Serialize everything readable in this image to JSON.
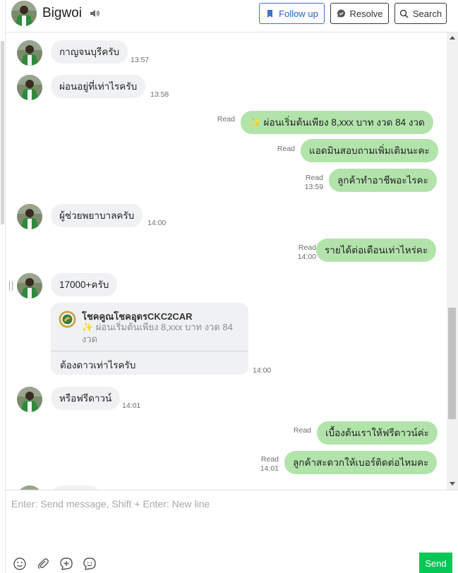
{
  "header": {
    "contact_name": "Bigwoi",
    "follow_up_label": "Follow up",
    "resolve_label": "Resolve",
    "search_label": "Search"
  },
  "messages": [
    {
      "dir": "in",
      "text": "กาญจนบุรีครับ",
      "time": "13:57"
    },
    {
      "dir": "in",
      "text": "ผ่อนอยู่ที่เท่าไรครับ",
      "time": "13:58"
    },
    {
      "dir": "out",
      "text": "✨ ผ่อนเริ่มต้นเพียง 8,xxx บาท งวด 84 งวด",
      "status": "Read",
      "time": ""
    },
    {
      "dir": "out",
      "text": "แอดมินสอบถามเพิ่มเติมนะคะ",
      "status": "Read",
      "time": ""
    },
    {
      "dir": "out",
      "text": "ลูกค้าทำอาชีพอะไรคะ",
      "status": "Read",
      "time": "13:59"
    },
    {
      "dir": "in",
      "text": "ผู้ช่วยพยาบาลครับ",
      "time": "14:00"
    },
    {
      "dir": "out",
      "text": "รายได้ต่อเดือนเท่าไหร่คะ",
      "status": "Read",
      "time": "14:00"
    },
    {
      "dir": "in",
      "text": "17000+ครับ",
      "time": ""
    },
    {
      "dir": "in-reply",
      "author": "โชคคูณโชคอุดรCKC2CAR",
      "quote": "✨ ผ่อนเริ่มต้นเพียง 8,xxx บาท งวด 84 งวด",
      "text": "ต้องดาวเท่าไรครับ",
      "time": "14:00"
    },
    {
      "dir": "in",
      "text": "หรือฟรีดาวน์",
      "time": "14:01"
    },
    {
      "dir": "out",
      "text": "เบื้องต้นเราให้ฟรีดาวน์ค่ะ",
      "status": "Read",
      "time": ""
    },
    {
      "dir": "out",
      "text": "ลูกค้าสะดวกให้เบอร์ติดต่อไหมคะ",
      "status": "Read",
      "time": "14:01"
    }
  ],
  "composer": {
    "placeholder": "Enter: Send message, Shift + Enter: New line",
    "send_label": "Send"
  },
  "colors": {
    "outgoing_bubble": "#b2e3ab",
    "incoming_bubble": "#f0f1f3",
    "send_button": "#06c755",
    "follow_up_accent": "#3d73c9"
  },
  "icons": {
    "sound": "speaker-icon",
    "follow_up": "bookmark-icon",
    "resolve": "chat-check-icon",
    "search": "search-icon",
    "emoji": "smiley-icon",
    "attach": "paperclip-icon",
    "template": "chat-plus-icon",
    "sticker": "sticker-icon"
  }
}
